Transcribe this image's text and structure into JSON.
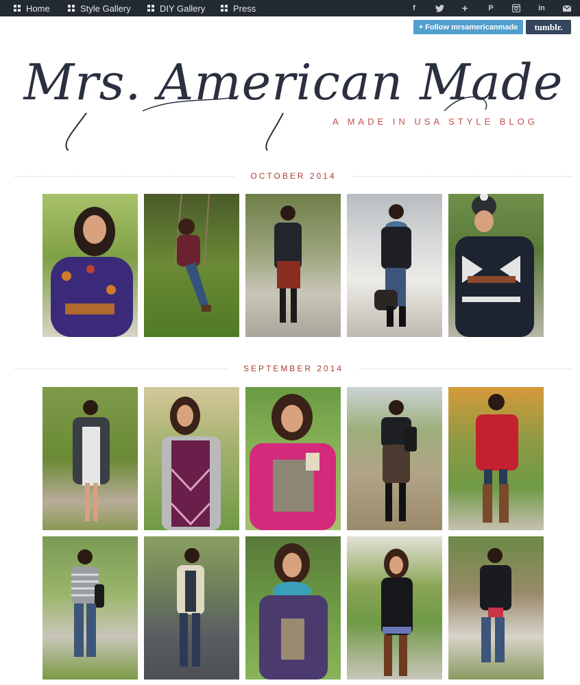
{
  "nav": {
    "items": [
      {
        "label": "Home"
      },
      {
        "label": "Style Gallery"
      },
      {
        "label": "DIY Gallery"
      },
      {
        "label": "Press"
      }
    ],
    "social": [
      {
        "icon": "facebook-icon",
        "glyph": "f"
      },
      {
        "icon": "twitter-icon",
        "glyph": "🐦"
      },
      {
        "icon": "plus-icon",
        "glyph": "+"
      },
      {
        "icon": "pinterest-icon",
        "glyph": "P"
      },
      {
        "icon": "instagram-icon",
        "glyph": "◘"
      },
      {
        "icon": "linkedin-icon",
        "glyph": "in"
      },
      {
        "icon": "email-icon",
        "glyph": "✉"
      }
    ]
  },
  "follow": {
    "follow_label": "+ Follow mrsamericanmade",
    "tumblr_label": "tumblr."
  },
  "header": {
    "title": "Mrs. American Made",
    "tagline": "A MADE IN USA STYLE BLOG"
  },
  "sections": [
    {
      "label": "OCTOBER 2014"
    },
    {
      "label": "SEPTEMBER 2014"
    }
  ],
  "colors": {
    "nav_bg": "#232a34",
    "accent": "#a83c36",
    "follow_blue": "#529ecc",
    "tumblr_navy": "#35465c"
  }
}
